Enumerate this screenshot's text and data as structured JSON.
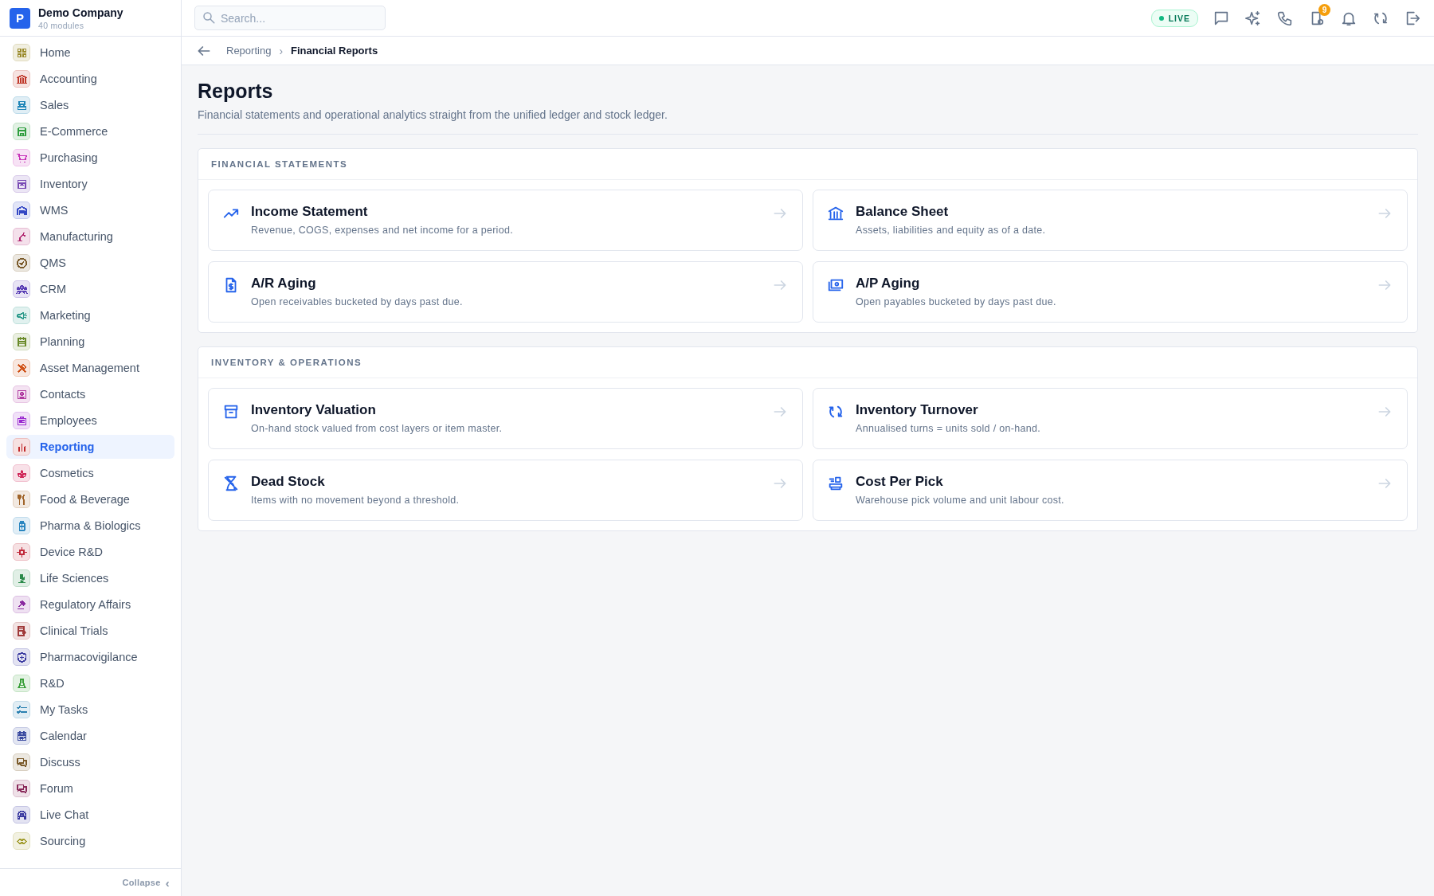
{
  "sidebar": {
    "company": {
      "initial": "P",
      "name": "Demo Company",
      "subtitle": "40 modules"
    },
    "items": [
      {
        "label": "Home",
        "color": "#9a8a2a",
        "selected": false
      },
      {
        "label": "Accounting",
        "color": "#c0392b",
        "selected": false
      },
      {
        "label": "Sales",
        "color": "#1f86b8",
        "selected": false
      },
      {
        "label": "E-Commerce",
        "color": "#2e9e3e",
        "selected": false
      },
      {
        "label": "Purchasing",
        "color": "#c832b8",
        "selected": false
      },
      {
        "label": "Inventory",
        "color": "#7a4bb5",
        "selected": false
      },
      {
        "label": "WMS",
        "color": "#3347c4",
        "selected": false
      },
      {
        "label": "Manufacturing",
        "color": "#b0236e",
        "selected": false
      },
      {
        "label": "QMS",
        "color": "#7a5a2a",
        "selected": false
      },
      {
        "label": "CRM",
        "color": "#5a3fb5",
        "selected": false
      },
      {
        "label": "Marketing",
        "color": "#2a9a8a",
        "selected": false
      },
      {
        "label": "Planning",
        "color": "#6a8a2a",
        "selected": false
      },
      {
        "label": "Asset Management",
        "color": "#d0541a",
        "selected": false
      },
      {
        "label": "Contacts",
        "color": "#b03aa0",
        "selected": false
      },
      {
        "label": "Employees",
        "color": "#9a2ad0",
        "selected": false
      },
      {
        "label": "Reporting",
        "color": "#c0282a",
        "selected": true
      },
      {
        "label": "Cosmetics",
        "color": "#d0285a",
        "selected": false
      },
      {
        "label": "Food & Beverage",
        "color": "#a0642a",
        "selected": false
      },
      {
        "label": "Pharma & Biologics",
        "color": "#2a86c0",
        "selected": false
      },
      {
        "label": "Device R&D",
        "color": "#c0283a",
        "selected": false
      },
      {
        "label": "Life Sciences",
        "color": "#2a8a4a",
        "selected": false
      },
      {
        "label": "Regulatory Affairs",
        "color": "#8a2aa0",
        "selected": false
      },
      {
        "label": "Clinical Trials",
        "color": "#a03a3a",
        "selected": false
      },
      {
        "label": "Pharmacovigilance",
        "color": "#3a3aa0",
        "selected": false
      },
      {
        "label": "R&D",
        "color": "#3aa03a",
        "selected": false
      },
      {
        "label": "My Tasks",
        "color": "#2a80b0",
        "selected": false
      },
      {
        "label": "Calendar",
        "color": "#3a4aa0",
        "selected": false
      },
      {
        "label": "Discuss",
        "color": "#7a5a2a",
        "selected": false
      },
      {
        "label": "Forum",
        "color": "#8a2a5a",
        "selected": false
      },
      {
        "label": "Live Chat",
        "color": "#3a3aa0",
        "selected": false
      },
      {
        "label": "Sourcing",
        "color": "#a09a2a",
        "selected": false
      }
    ],
    "collapse": {
      "label": "Collapse",
      "icon": "‹"
    }
  },
  "topbar": {
    "search": {
      "placeholder": "Search..."
    },
    "live_badge": "LIVE",
    "notification_count": "9"
  },
  "breadcrumb": {
    "separator": "›",
    "items": [
      {
        "label": "Reporting",
        "current": false
      },
      {
        "label": "Financial Reports",
        "current": true
      }
    ]
  },
  "page": {
    "title": "Reports",
    "subtitle": "Financial statements and operational analytics straight from the unified ledger and stock ledger."
  },
  "sections": [
    {
      "title": "FINANCIAL STATEMENTS",
      "cards": [
        {
          "title": "Income Statement",
          "description": "Revenue, COGS, expenses and net income for a period."
        },
        {
          "title": "Balance Sheet",
          "description": "Assets, liabilities and equity as of a date."
        },
        {
          "title": "A/R Aging",
          "description": "Open receivables bucketed by days past due."
        },
        {
          "title": "A/P Aging",
          "description": "Open payables bucketed by days past due."
        }
      ]
    },
    {
      "title": "INVENTORY & OPERATIONS",
      "cards": [
        {
          "title": "Inventory Valuation",
          "description": "On-hand stock valued from cost layers or item master."
        },
        {
          "title": "Inventory Turnover",
          "description": "Annualised turns = units sold / on-hand."
        },
        {
          "title": "Dead Stock",
          "description": "Items with no movement beyond a threshold."
        },
        {
          "title": "Cost Per Pick",
          "description": "Warehouse pick volume and unit labour cost."
        }
      ]
    }
  ]
}
